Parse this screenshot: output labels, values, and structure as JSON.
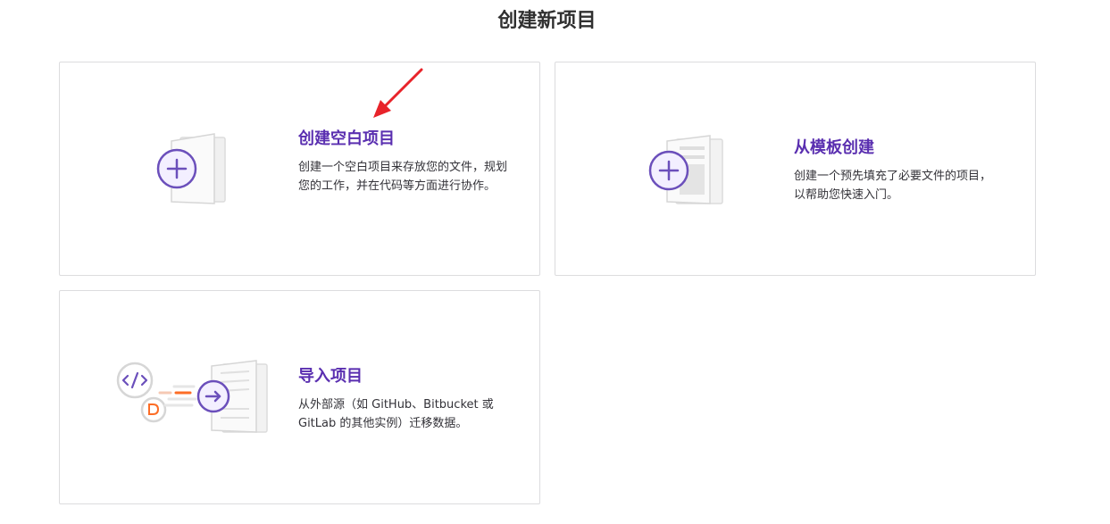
{
  "page": {
    "title": "创建新项目"
  },
  "cards": [
    {
      "title": "创建空白项目",
      "description": "创建一个空白项目来存放您的文件，规划您的工作，并在代码等方面进行协作。"
    },
    {
      "title": "从模板创建",
      "description": "创建一个预先填充了必要文件的项目，以帮助您快速入门。"
    },
    {
      "title": "导入项目",
      "description": "从外部源（如 GitHub、Bitbucket 或 GitLab 的其他实例）迁移数据。"
    }
  ],
  "colors": {
    "accent": "#6b4fbb",
    "title_text": "#5a2fb0",
    "annotation_arrow": "#e8232a",
    "card_border": "#dcdcde",
    "import_orange": "#fc6d26"
  },
  "icons": {
    "blank_project": "plus-circle-document-icon",
    "template_project": "plus-circle-template-icon",
    "import_project": "arrow-circle-import-icon"
  }
}
